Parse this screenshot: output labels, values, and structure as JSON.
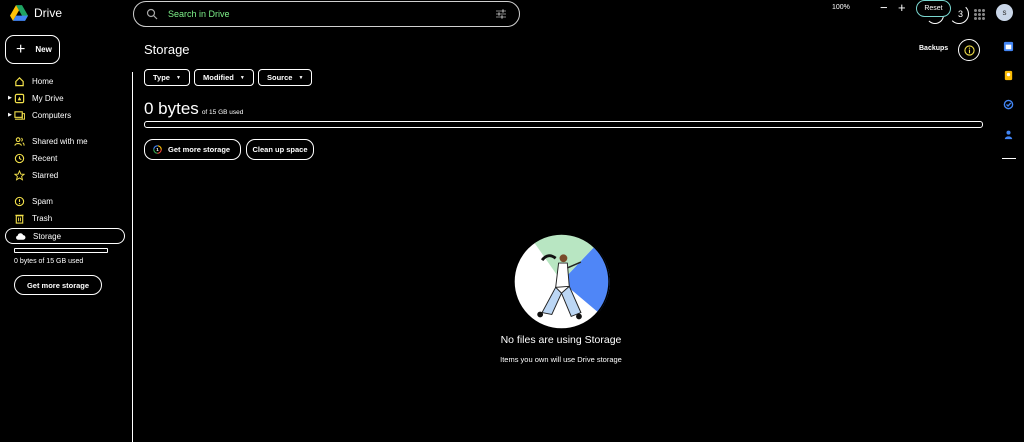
{
  "app": {
    "name": "Drive"
  },
  "search": {
    "placeholder": "Search in Drive"
  },
  "zoom": {
    "level": "100%",
    "minus": "−",
    "plus": "+",
    "reset": "Reset",
    "badge": "3"
  },
  "account": {
    "initial": "s"
  },
  "sidebar": {
    "new_label": "New",
    "items": [
      {
        "label": "Home",
        "icon": "home-icon"
      },
      {
        "label": "My Drive",
        "icon": "my-drive-icon"
      },
      {
        "label": "Computers",
        "icon": "computers-icon"
      },
      {
        "label": "Shared with me",
        "icon": "shared-icon"
      },
      {
        "label": "Recent",
        "icon": "recent-icon"
      },
      {
        "label": "Starred",
        "icon": "star-icon"
      },
      {
        "label": "Spam",
        "icon": "spam-icon"
      },
      {
        "label": "Trash",
        "icon": "trash-icon"
      },
      {
        "label": "Storage",
        "icon": "cloud-icon"
      }
    ],
    "storage_used": "0 bytes of 15 GB used",
    "get_more_storage": "Get more storage"
  },
  "main": {
    "title": "Storage",
    "backups_label": "Backups",
    "filters": [
      "Type",
      "Modified",
      "Source"
    ],
    "usage_value": "0 bytes",
    "usage_total": "of 15 GB used",
    "usage_fraction": 0,
    "get_more_storage": "Get more storage",
    "clean_up": "Clean up space",
    "empty_title": "No files are using Storage",
    "empty_subtitle": "Items you own will use Drive storage"
  },
  "colors": {
    "search_text": "#7ef28a",
    "nav_icon": "#f4e24b",
    "reset_border": "#7ad7d0",
    "accent_blue": "#4f86f7",
    "accent_green": "#b8e6c2"
  }
}
